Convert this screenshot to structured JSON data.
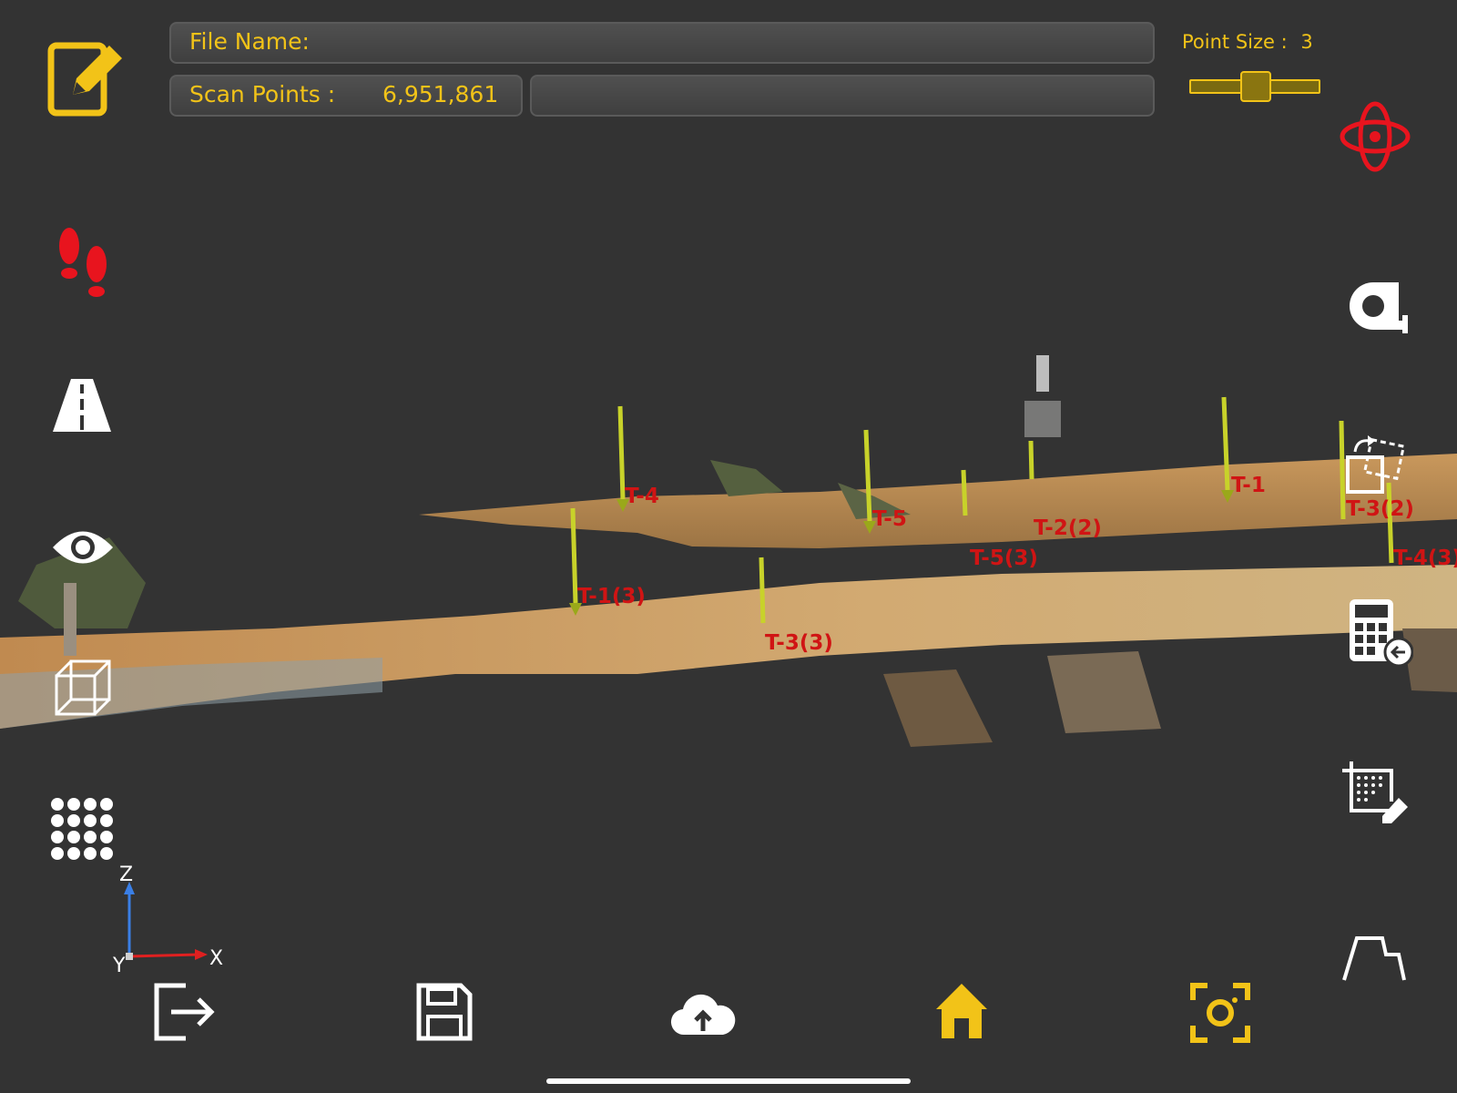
{
  "header": {
    "file_name_label": "File Name:",
    "file_name_value": "",
    "scan_points_label": "Scan Points :",
    "scan_points_value": "6,951,861",
    "point_size_label": "Point Size :",
    "point_size_value": "3"
  },
  "markers": [
    "T-4",
    "T-5",
    "T-1",
    "T-2(2)",
    "T-3(2)",
    "T-5(3)",
    "T-4(3)",
    "T-1(3)",
    "T-3(3)"
  ],
  "axis": {
    "z": "Z",
    "x": "X",
    "y": "Y"
  },
  "colors": {
    "accent": "#f2c318",
    "alert": "#e8141e",
    "marker_text": "#d01414",
    "background": "#333333"
  },
  "icons": {
    "left": [
      "edit-icon",
      "footprints-icon",
      "road-icon",
      "eye-icon",
      "wireframe-box-icon",
      "dot-grid-icon"
    ],
    "right": [
      "rotate-3d-icon",
      "tape-measure-icon",
      "transform-copy-icon",
      "calculator-icon",
      "crop-area-icon",
      "profile-icon"
    ],
    "bottom": [
      "exit-icon",
      "save-icon",
      "cloud-upload-icon",
      "home-icon",
      "camera-focus-icon"
    ]
  }
}
